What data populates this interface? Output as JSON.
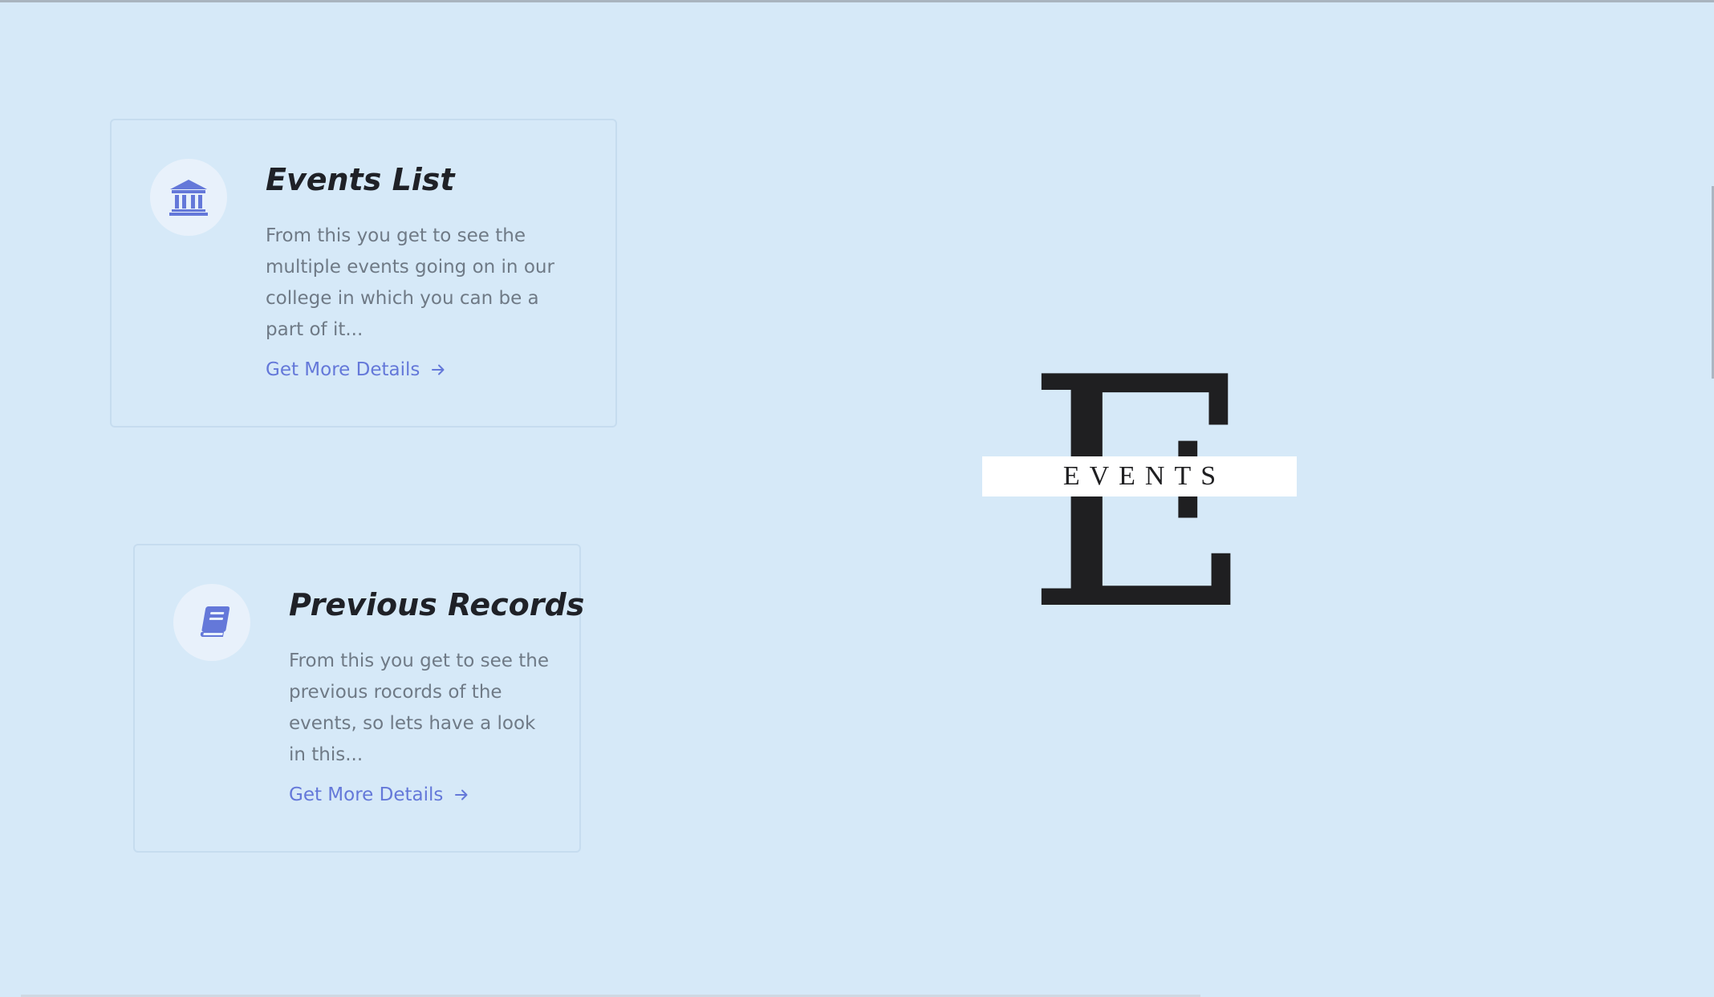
{
  "cards": [
    {
      "title": "Events List",
      "description": "From this you get to see the multiple events going on in our college in which you can be a part of it...",
      "link_label": "Get More Details",
      "icon": "bank-building-icon"
    },
    {
      "title": "Previous Records",
      "description": "From this you get to see the previous rocords of the events, so lets have a look in this...",
      "link_label": "Get More Details",
      "icon": "book-icon"
    }
  ],
  "logo": {
    "letter": "E",
    "word": "EVENTS"
  },
  "colors": {
    "background": "#d6e9f8",
    "accent": "#6478d9",
    "title": "#1f2127",
    "body_text": "#6f7a86",
    "icon_circle": "#e8f1fb"
  }
}
